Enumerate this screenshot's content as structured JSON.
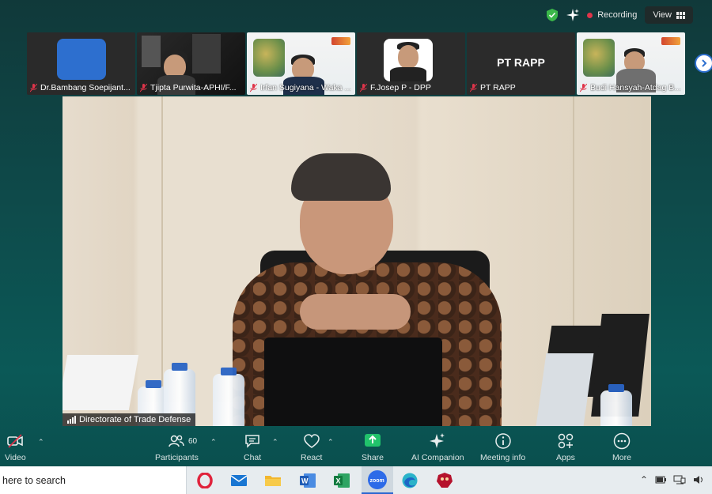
{
  "topbar": {
    "recording_label": "Recording",
    "view_label": "View",
    "colors": {
      "recording_dot": "#e0344a",
      "shield": "#3bb84a"
    }
  },
  "participants_strip": [
    {
      "name": "Dr.Bambang Soepijant...",
      "muted": true
    },
    {
      "name": "Tjipta Purwita-APHI/F...",
      "muted": true
    },
    {
      "name": "Irfan Sugiyana - Waka ...",
      "muted": true
    },
    {
      "name": "F.Josep P - DPP",
      "muted": true
    },
    {
      "name": "PT RAPP",
      "muted": true,
      "tile_text": "PT RAPP"
    },
    {
      "name": "Budi Hansyah-Atdag B...",
      "muted": true
    }
  ],
  "main_video": {
    "speaker_label": "Directorate of Trade Defense"
  },
  "toolbar": {
    "video_label": "Video",
    "participants_label": "Participants",
    "participants_count": "60",
    "chat_label": "Chat",
    "react_label": "React",
    "share_label": "Share",
    "ai_label": "AI Companion",
    "meeting_info_label": "Meeting info",
    "apps_label": "Apps",
    "more_label": "More",
    "colors": {
      "share_green": "#21c26b"
    }
  },
  "taskbar": {
    "search_text": "here to search",
    "apps": [
      "opera-icon",
      "mail-icon",
      "file-explorer-icon",
      "word-icon",
      "excel-icon",
      "zoom-icon",
      "edge-icon",
      "game-icon"
    ],
    "zoom_label": "zoom"
  }
}
